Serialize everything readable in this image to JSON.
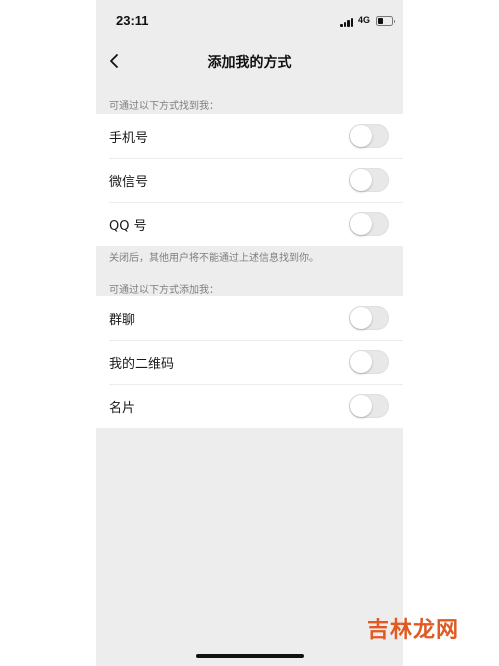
{
  "status_bar": {
    "time": "23:11",
    "network": "4G"
  },
  "nav": {
    "title": "添加我的方式"
  },
  "find_section": {
    "header": "可通过以下方式找到我：",
    "items": [
      {
        "label": "手机号",
        "enabled": false
      },
      {
        "label": "微信号",
        "enabled": false
      },
      {
        "label": "QQ 号",
        "enabled": false
      }
    ],
    "footnote": "关闭后，其他用户将不能通过上述信息找到你。"
  },
  "add_section": {
    "header": "可通过以下方式添加我：",
    "items": [
      {
        "label": "群聊",
        "enabled": false
      },
      {
        "label": "我的二维码",
        "enabled": false
      },
      {
        "label": "名片",
        "enabled": false
      }
    ]
  },
  "watermark": "吉林龙网",
  "colors": {
    "background": "#ededed",
    "watermark": "#e05a22",
    "toggle_off": "#e8e8e8"
  }
}
